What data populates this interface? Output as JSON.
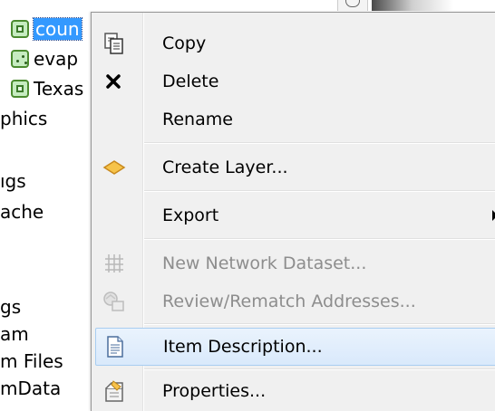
{
  "tree": {
    "items": [
      {
        "label": "coun",
        "icon": "raster-layer-icon",
        "selected": true
      },
      {
        "label": "evap",
        "icon": "point-layer-icon",
        "selected": false
      },
      {
        "label": "Texas",
        "icon": "raster-layer-icon",
        "selected": false
      },
      {
        "label": "phics"
      },
      {
        "label": "ıgs"
      },
      {
        "label": "ache"
      },
      {
        "label": "gs"
      },
      {
        "label": "am"
      },
      {
        "label": "m Files"
      },
      {
        "label": "mData"
      }
    ]
  },
  "context_menu": {
    "items": [
      {
        "label": "Copy",
        "icon": "copy-icon",
        "enabled": true
      },
      {
        "label": "Delete",
        "icon": "delete-icon",
        "enabled": true
      },
      {
        "label": "Rename",
        "icon": "",
        "enabled": true
      },
      {
        "label": "Create Layer...",
        "icon": "create-layer-icon",
        "enabled": true
      },
      {
        "label": "Export",
        "icon": "",
        "enabled": true,
        "submenu": true
      },
      {
        "label": "New Network Dataset...",
        "icon": "network-dataset-icon",
        "enabled": false
      },
      {
        "label": "Review/Rematch Addresses...",
        "icon": "rematch-addresses-icon",
        "enabled": false
      },
      {
        "label": "Item Description...",
        "icon": "item-description-icon",
        "enabled": true,
        "highlighted": true
      },
      {
        "label": "Properties...",
        "icon": "properties-icon",
        "enabled": true
      }
    ]
  },
  "colors": {
    "selection": "#3399ff",
    "menu_background": "#f0f0f0",
    "highlight_border": "#a8cdf1",
    "disabled_text": "#8d8d8d"
  }
}
